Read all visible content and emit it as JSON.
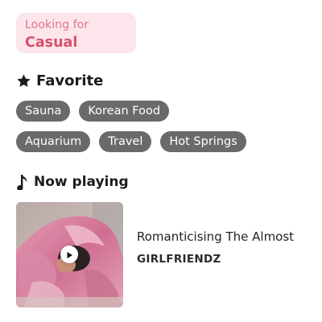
{
  "looking_for": {
    "label": "Looking for",
    "value": "Casual"
  },
  "favorite": {
    "heading": "Favorite",
    "icon": "star-icon",
    "rows": [
      [
        "Sauna",
        "Korean Food"
      ],
      [
        "Aquarium",
        "Travel",
        "Hot Springs"
      ]
    ]
  },
  "now_playing": {
    "heading": "Now playing",
    "icon": "music-note-icon",
    "track_title": "Romanticising The Almost",
    "artist": "GIRLFRIENDZ",
    "cover": "album-cover-image",
    "play_icon": "play-icon"
  },
  "colors": {
    "looking_bg": "#fce6ec",
    "looking_label": "#e0758c",
    "looking_value": "#d6506d",
    "chip_bg": "#6a6a6a",
    "chip_text": "#ffffff"
  }
}
